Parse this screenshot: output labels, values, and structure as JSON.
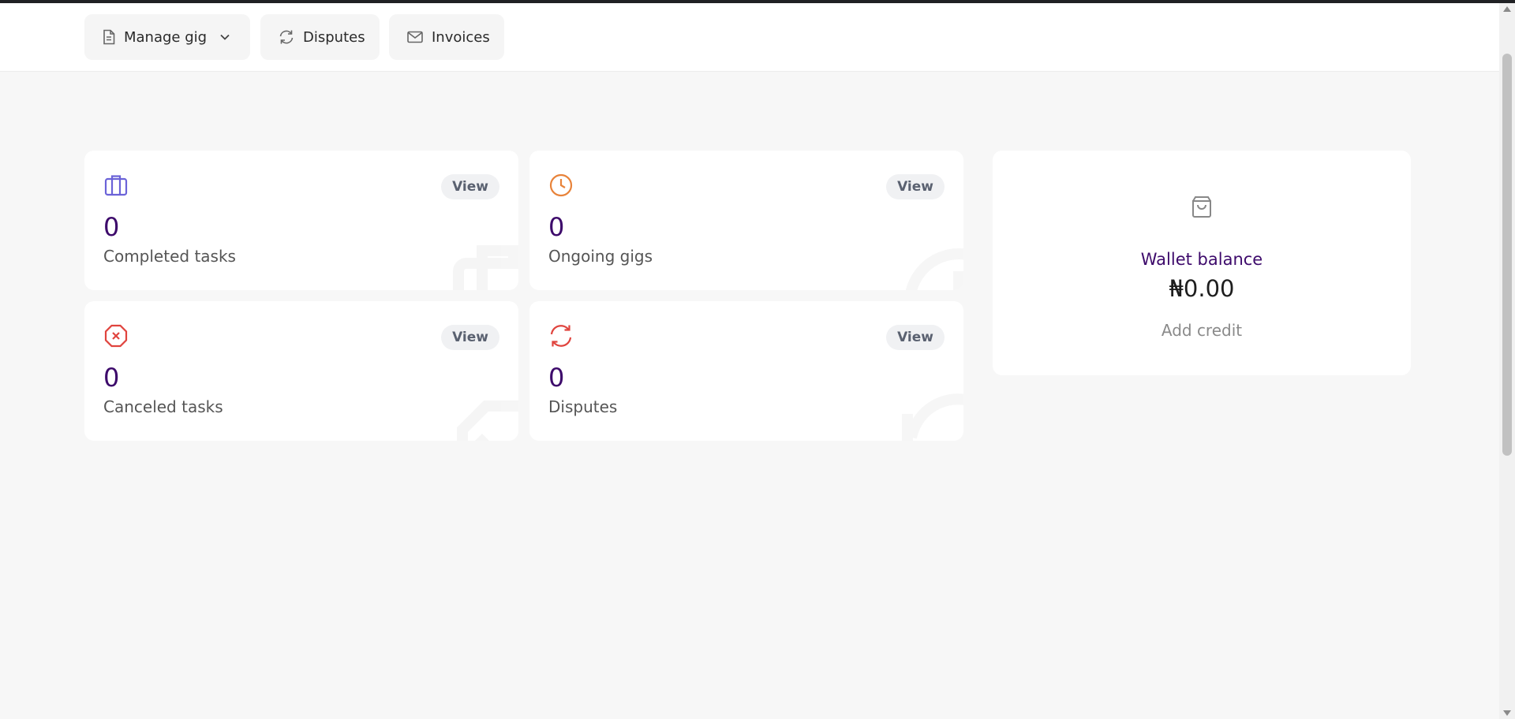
{
  "nav": {
    "manage_gig": "Manage gig",
    "disputes": "Disputes",
    "invoices": "Invoices"
  },
  "cards": {
    "completed": {
      "value": "0",
      "label": "Completed tasks",
      "view": "View",
      "icon": "briefcase-icon",
      "color": "#6b63d8"
    },
    "ongoing": {
      "value": "0",
      "label": "Ongoing gigs",
      "view": "View",
      "icon": "clock-icon",
      "color": "#e8833a"
    },
    "canceled": {
      "value": "0",
      "label": "Canceled tasks",
      "view": "View",
      "icon": "x-octagon-icon",
      "color": "#e0443e"
    },
    "disputes": {
      "value": "0",
      "label": "Disputes",
      "view": "View",
      "icon": "refresh-icon",
      "color": "#e0443e"
    }
  },
  "wallet": {
    "label": "Wallet balance",
    "amount": "₦0.00",
    "add_credit": "Add credit",
    "icon": "shopping-bag-icon"
  },
  "colors": {
    "accent": "#3d0a6b",
    "background": "#f7f7f7"
  }
}
